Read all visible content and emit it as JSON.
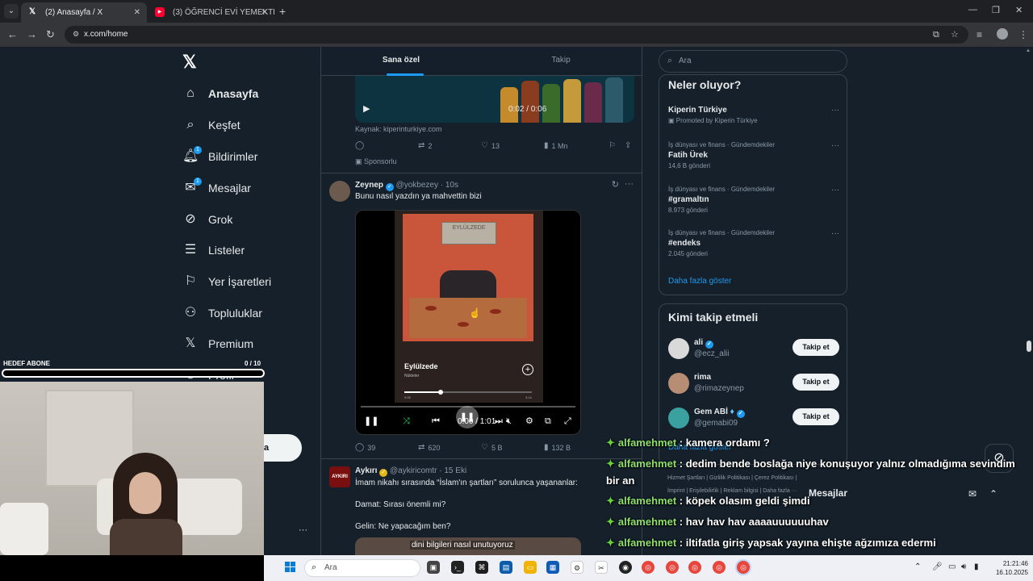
{
  "browser": {
    "tabs": [
      {
        "title": "(2) Anasayfa / X",
        "active": true
      },
      {
        "title": "(3) ÖĞRENCİ EVİ YEMEKTEYİZ...",
        "active": false
      }
    ],
    "url": "x.com/home"
  },
  "nav": {
    "items": [
      {
        "label": "Anasayfa",
        "icon": "home-icon"
      },
      {
        "label": "Keşfet",
        "icon": "search-icon"
      },
      {
        "label": "Bildirimler",
        "icon": "bell-icon",
        "badge": "1"
      },
      {
        "label": "Mesajlar",
        "icon": "mail-icon",
        "badge": "1"
      },
      {
        "label": "Grok",
        "icon": "grok-icon"
      },
      {
        "label": "Listeler",
        "icon": "list-icon"
      },
      {
        "label": "Yer İşaretleri",
        "icon": "bookmark-icon"
      },
      {
        "label": "Topluluklar",
        "icon": "people-icon"
      },
      {
        "label": "Premium",
        "icon": "x-icon"
      },
      {
        "label": "Profil",
        "icon": "person-icon"
      }
    ],
    "post_button": "la"
  },
  "timeline": {
    "tabs": [
      "Sana özel",
      "Takip"
    ],
    "ad": {
      "video_time": "0:02 / 0:06",
      "source": "Kaynak: kiperinturkiye.com",
      "retweets": "2",
      "likes": "13",
      "views": "1 Mn",
      "sponsored": "Sponsorlu"
    },
    "tweet1": {
      "name": "Zeynep",
      "handle": "@yokbezey",
      "time": "10s",
      "text": "Bunu nasıl yazdın ya mahvettin bizi",
      "song_title": "Eylülzede",
      "song_artist": "Nükleler",
      "sign_text": "EYLÜLZEDE",
      "song_elapsed": "0:05",
      "song_total": "3:14",
      "video_time": "0:00 / 1:01",
      "replies": "39",
      "retweets": "620",
      "likes": "5 B",
      "views": "132 B"
    },
    "tweet2": {
      "avatar_text": "AYKIRI",
      "name": "Aykırı",
      "handle": "@aykiricomtr",
      "time": "15 Eki",
      "lines": [
        "İmam nikahı sırasında “İslam'ın şartları” sorulunca yaşananlar:",
        "Damat: Sırası önemli mi?",
        "Gelin: Ne yapacağım ben?"
      ],
      "media_caption": "dini bilgileri nasıl unutuyoruz"
    }
  },
  "sidebar": {
    "search_placeholder": "Ara",
    "trends_title": "Neler oluyor?",
    "promoted": {
      "title": "Kiperin Türkiye",
      "meta": "Promoted by Kiperin Türkiye"
    },
    "trends": [
      {
        "meta": "İş dünyası ve finans · Gündemdekiler",
        "title": "Fatih Ürek",
        "count": "14,6 B gönderi"
      },
      {
        "meta": "İş dünyası ve finans · Gündemdekiler",
        "title": "#gramaltın",
        "count": "8.973 gönderi"
      },
      {
        "meta": "İş dünyası ve finans · Gündemdekiler",
        "title": "#endeks",
        "count": "2.045 gönderi"
      }
    ],
    "show_more": "Daha fazla göster",
    "who_title": "Kimi takip etmeli",
    "who": [
      {
        "name": "ali",
        "handle": "@ecz_alii",
        "button": "Takip et",
        "verified": true
      },
      {
        "name": "rima",
        "handle": "@rimazeynep",
        "button": "Takip et",
        "verified": false
      },
      {
        "name": "Gem ABİ",
        "handle": "@gemabi09",
        "button": "Takip et",
        "verified": true
      }
    ],
    "who_more": "Daha fazla göster",
    "footer1": "Hizmet Şartları  |  Gizlilik Politikası  |  Çerez Politikası  |",
    "footer2": "İmprint  |  Erişilebilirlik  |  Reklam bilgisi  |  Daha fazla ···",
    "messages": "Mesajlar"
  },
  "overlay": {
    "goal_label": "HEDEF ABONE",
    "goal_count": "0  / 10",
    "chat": [
      {
        "user": "alfamehmet",
        "text": " : kamera ordamı ?"
      },
      {
        "user": "alfamehmet",
        "text": " : dedim bende boslağa niye konuşuyor yalnız olmadığıma sevindim"
      },
      {
        "user": "",
        "text": "bir an"
      },
      {
        "user": "alfamehmet",
        "text": " : köpek olasım geldi şimdi"
      },
      {
        "user": "alfamehmet",
        "text": " : hav hav hav aaaauuuuuuhav"
      },
      {
        "user": "alfamehmet",
        "text": " : iltifatla giriş yapsak yayına ehişte ağzımıza edermi"
      }
    ]
  },
  "taskbar": {
    "search_placeholder": "Ara",
    "time": "21:21:46",
    "date": "16.10.2025"
  },
  "colors": {
    "x_bg": "#15202b",
    "accent": "#1d9bf0",
    "border": "#38444d",
    "chat_user": "#8ee06a"
  }
}
